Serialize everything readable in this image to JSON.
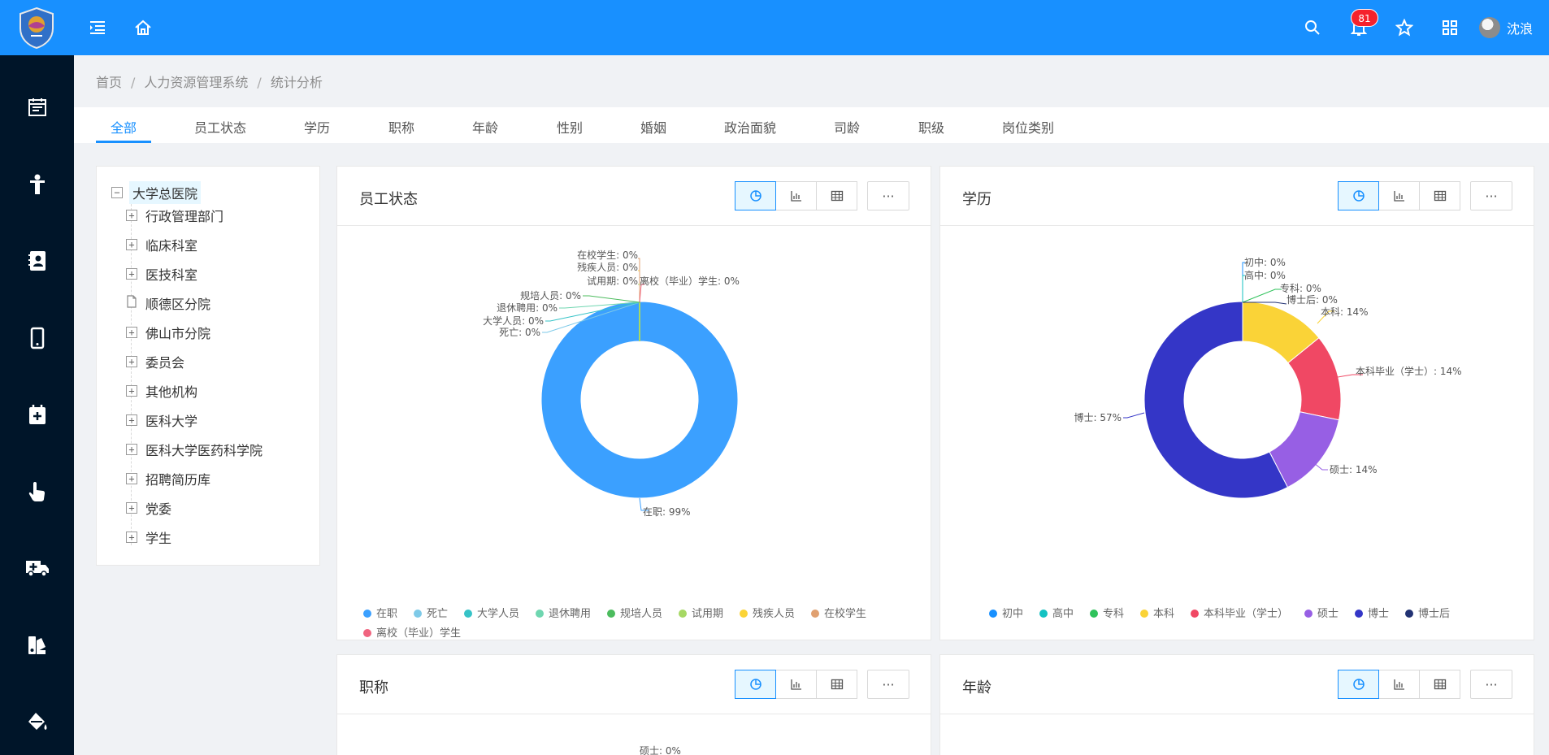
{
  "header": {
    "notification_count": "81",
    "user_name": "沈浪"
  },
  "breadcrumb": [
    "首页",
    "人力资源管理系统",
    "统计分析"
  ],
  "tabs": [
    "全部",
    "员工状态",
    "学历",
    "职称",
    "年龄",
    "性别",
    "婚姻",
    "政治面貌",
    "司龄",
    "职级",
    "岗位类别"
  ],
  "active_tab": "全部",
  "tree": {
    "root": "大学总医院",
    "items": [
      "行政管理部门",
      "临床科室",
      "医技科室",
      "顺德区分院",
      "佛山市分院",
      "委员会",
      "其他机构",
      "医科大学",
      "医科大学医药科学院",
      "招聘简历库",
      "党委",
      "学生"
    ]
  },
  "cards": {
    "status": {
      "title": "员工状态"
    },
    "education": {
      "title": "学历"
    },
    "title_rank": {
      "title": "职称",
      "partial_label": "硕士: 0%"
    },
    "age": {
      "title": "年龄"
    }
  },
  "more_label": "···",
  "chart_data": [
    {
      "type": "pie",
      "title": "员工状态",
      "donut": true,
      "legend_position": "bottom",
      "categories": [
        "在职",
        "死亡",
        "大学人员",
        "退休聘用",
        "规培人员",
        "试用期",
        "残疾人员",
        "在校学生",
        "离校（毕业）学生"
      ],
      "values": [
        99,
        0,
        0,
        0,
        0,
        0,
        0,
        0,
        0
      ],
      "labels": [
        "在职: 99%",
        "死亡: 0%",
        "大学人员: 0%",
        "退休聘用: 0%",
        "规培人员: 0%",
        "试用期: 0%",
        "残疾人员: 0%",
        "在校学生: 0%",
        "离校（毕业）学生: 0%"
      ],
      "colors": [
        "#3ba0ff",
        "#7ecae8",
        "#36c3c7",
        "#6fd6b0",
        "#4cbc5e",
        "#a6d864",
        "#fbd437",
        "#e0a070",
        "#f0647f"
      ]
    },
    {
      "type": "pie",
      "title": "学历",
      "donut": true,
      "legend_position": "bottom",
      "categories": [
        "初中",
        "高中",
        "专科",
        "本科",
        "本科毕业（学士）",
        "硕士",
        "博士",
        "博士后"
      ],
      "values": [
        0,
        0,
        0,
        14,
        14,
        14,
        57,
        0
      ],
      "labels": [
        "初中: 0%",
        "高中: 0%",
        "专科: 0%",
        "本科: 14%",
        "本科毕业（学士）: 14%",
        "硕士: 14%",
        "博士: 57%",
        "博士后: 0%"
      ],
      "colors": [
        "#1890ff",
        "#13c2c2",
        "#2fc25b",
        "#fad337",
        "#f04864",
        "#975fe4",
        "#3436c7",
        "#223273"
      ]
    }
  ]
}
